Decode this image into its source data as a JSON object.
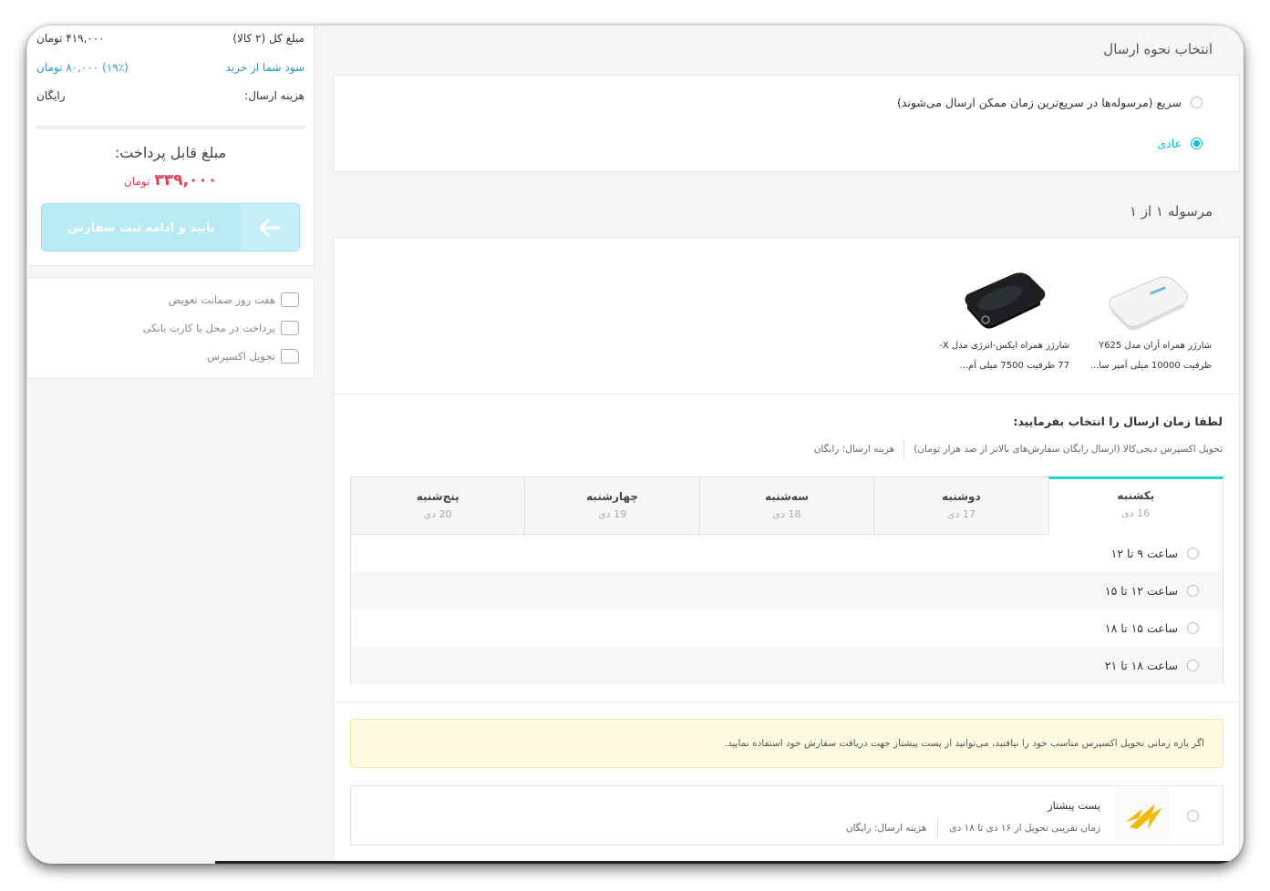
{
  "shipping": {
    "title": "انتخاب نحوه ارسال",
    "options": [
      {
        "label": "سریع (مرسوله‌ها در سریع‌ترین زمان ممکن ارسال می‌شوند)",
        "selected": false
      },
      {
        "label": "عادی",
        "selected": true
      }
    ]
  },
  "parcel": {
    "title": "مرسوله ۱ از ۱",
    "products": [
      {
        "name_line1": "شارژر همراه آران مدل Y625",
        "name_line2": "ظرفیت 10000 میلی آمپر سا..."
      },
      {
        "name_line1": "شارژر همراه ایکس-انرژی مدل X-",
        "name_line2": "77 ظرفیت 7500 میلی آم..."
      }
    ],
    "time_prompt": "لطفا زمان ارسال را انتخاب بفرمایید:",
    "express_info": "تحویل اکسپرس دیجی‌کالا (ارسال رایگان سفارش‌های بالاتر از صد هزار تومان)",
    "shipping_cost": "هزینه ارسال: رایگان",
    "days": [
      {
        "day": "یکشنبه",
        "date": "16 دی",
        "active": true
      },
      {
        "day": "دوشنبه",
        "date": "17 دی",
        "active": false
      },
      {
        "day": "سه‌شنبه",
        "date": "18 دی",
        "active": false
      },
      {
        "day": "چهارشنبه",
        "date": "19 دی",
        "active": false
      },
      {
        "day": "پنج‌شنبه",
        "date": "20 دی",
        "active": false
      }
    ],
    "slots": [
      "ساعت ۹ تا ۱۲",
      "ساعت ۱۲ تا ۱۵",
      "ساعت ۱۵ تا ۱۸",
      "ساعت ۱۸ تا ۲۱"
    ],
    "notice": "اگر بازه زمانی تحویل اکسپرس مناسب خود را نیافتید، می‌توانید از پست پیشتاز جهت دریافت سفارش خود استفاده نمایید.",
    "post": {
      "title": "پست پیشتاز",
      "eta": "زمان تقریبی تحویل از ۱۶ دی تا ۱۸ دی",
      "cost": "هزینه ارسال: رایگان"
    }
  },
  "summary": {
    "total_label": "مبلغ کل (۲ کالا)",
    "total_value": "۴۱۹,۰۰۰ تومان",
    "discount_label": "سود شما از خرید",
    "discount_value": "(۱۹٪) ۸۰,۰۰۰ تومان",
    "shipping_label": "هزینه ارسال:",
    "shipping_value": "رایگان",
    "payable_label": "مبلغ قابل پرداخت:",
    "payable_amount": "۳۳۹,۰۰۰",
    "payable_currency": "تومان",
    "confirm_button": "تایید و ادامه ثبت سفارش"
  },
  "features": [
    {
      "label": "هفت روز ضمانت تعویض",
      "icon": "seven-day-guarantee-icon"
    },
    {
      "label": "پرداخت در محل با کارت بانکی",
      "icon": "pay-on-delivery-icon"
    },
    {
      "label": "تحویل اکسپرس",
      "icon": "express-delivery-icon"
    }
  ],
  "colors": {
    "accent": "#00bfd6",
    "price_red": "#ef394e",
    "tab_active": "#20d6c8",
    "notice_bg": "#fffbe0"
  }
}
